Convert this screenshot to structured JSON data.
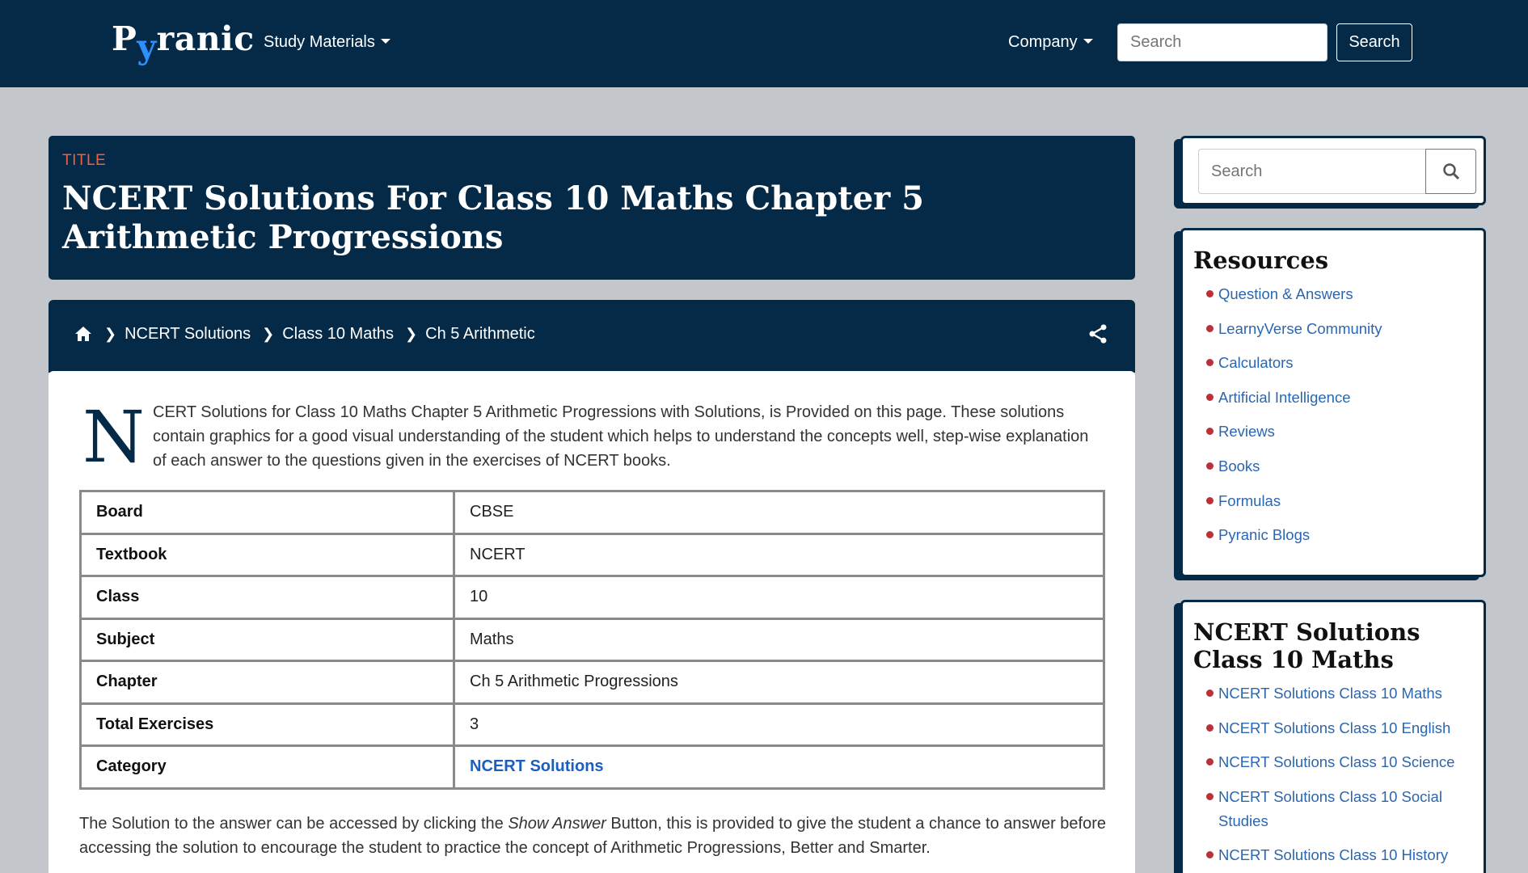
{
  "nav": {
    "logo_pre": "P",
    "logo_y": "y",
    "logo_post": "ranic",
    "study_materials": "Study Materials",
    "company": "Company",
    "search_placeholder": "Search",
    "search_button": "Search"
  },
  "title_card": {
    "label": "TITLE",
    "title": "NCERT Solutions For Class 10 Maths Chapter 5 Arithmetic Progressions"
  },
  "breadcrumb": {
    "items": [
      "NCERT Solutions",
      "Class 10 Maths",
      "Ch 5 Arithmetic"
    ]
  },
  "intro": {
    "dropcap": "N",
    "text": "CERT Solutions for Class 10 Maths Chapter 5 Arithmetic Progressions with Solutions, is Provided on this page. These solutions contain graphics for a good visual understanding of the student which helps to understand the concepts well, step-wise explanation of each answer to the questions given in the exercises of NCERT books."
  },
  "info_table": [
    {
      "key": "Board",
      "value": "CBSE"
    },
    {
      "key": "Textbook",
      "value": "NCERT"
    },
    {
      "key": "Class",
      "value": "10"
    },
    {
      "key": "Subject",
      "value": "Maths"
    },
    {
      "key": "Chapter",
      "value": "Ch 5 Arithmetic Progressions"
    },
    {
      "key": "Total Exercises",
      "value": "3"
    },
    {
      "key": "Category",
      "value": "NCERT Solutions"
    }
  ],
  "note": {
    "before": "The Solution to the answer can be accessed by clicking the ",
    "emph": "Show Answer",
    "after": " Button, this is provided to give the student a chance to answer before accessing the solution to encourage the student to practice the concept of Arithmetic Progressions, Better and Smarter."
  },
  "sidebar": {
    "search_placeholder": "Search",
    "resources_title": "Resources",
    "resources": [
      "Question & Answers",
      "LearnyVerse Community",
      "Calculators",
      "Artificial Intelligence",
      "Reviews",
      "Books",
      "Formulas",
      "Pyranic Blogs"
    ],
    "ncert_title": "NCERT Solutions Class 10 Maths",
    "ncert_links": [
      "NCERT Solutions Class 10 Maths",
      "NCERT Solutions Class 10 English",
      "NCERT Solutions Class 10 Science",
      "NCERT Solutions Class 10 Social Studies",
      "NCERT Solutions Class 10 History"
    ]
  },
  "colors": {
    "navy": "#042a48",
    "accent_orange": "#f0603e",
    "link_blue": "#2b66b0",
    "bullet_red": "#b8323a",
    "page_bg": "#c3c7cc"
  },
  "icons": [
    "home-icon",
    "chevron-right-icon",
    "share-icon",
    "search-icon",
    "caret-down-icon"
  ]
}
